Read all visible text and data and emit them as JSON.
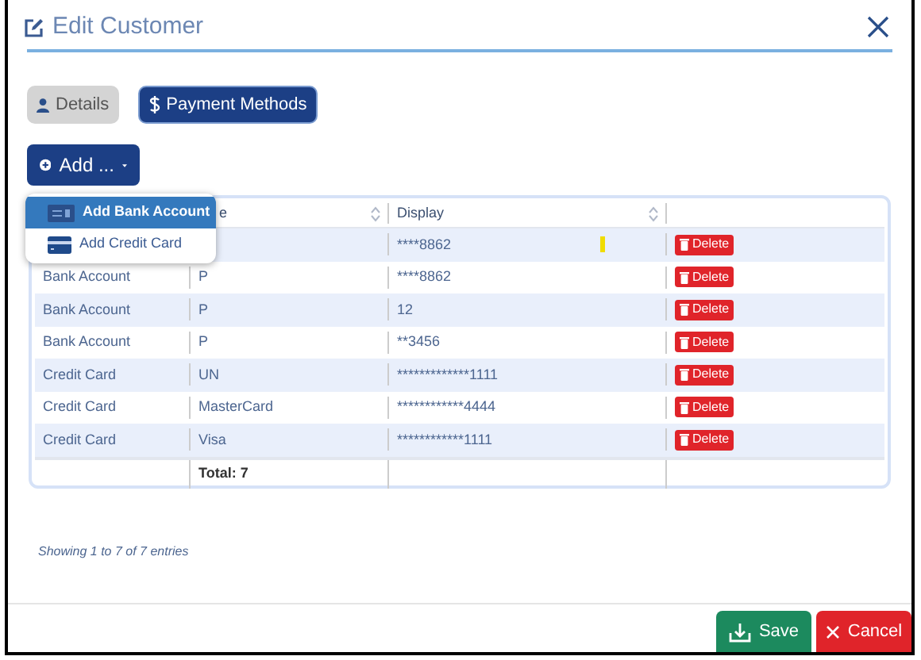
{
  "window": {
    "title": "Edit Customer"
  },
  "tabs": [
    {
      "label": "Details",
      "selected": false
    },
    {
      "label": "Payment Methods",
      "selected": true
    }
  ],
  "add_button": {
    "label": "Add ..."
  },
  "add_menu": [
    {
      "label": "Add Bank Account",
      "kind": "bank",
      "selected": true
    },
    {
      "label": "Add Credit Card",
      "kind": "card",
      "selected": false
    }
  ],
  "table": {
    "columns": [
      "e",
      "Display"
    ],
    "rows": [
      {
        "display": "****8862",
        "marker": true,
        "action": "Delete"
      },
      {
        "type": "Bank Account",
        "name": "P",
        "display": "****8862",
        "marker": false,
        "action": "Delete"
      },
      {
        "type": "Bank Account",
        "name": "P",
        "display": "12",
        "marker": false,
        "action": "Delete"
      },
      {
        "type": "Bank Account",
        "name": "P",
        "display": "**3456",
        "marker": false,
        "action": "Delete"
      },
      {
        "type": "Credit Card",
        "name": "UN",
        "display": "*************1111",
        "marker": false,
        "action": "Delete"
      },
      {
        "type": "Credit Card",
        "name": "MasterCard",
        "display": "************4444",
        "marker": false,
        "action": "Delete"
      },
      {
        "type": "Credit Card",
        "name": "Visa",
        "display": "************1111",
        "marker": false,
        "action": "Delete"
      }
    ],
    "total": "Total: 7"
  },
  "info": "Showing 1 to 7 of 7 entries",
  "buttons": [
    {
      "label": "Save",
      "kind": "save"
    },
    {
      "label": "Cancel",
      "kind": "cancel"
    }
  ]
}
